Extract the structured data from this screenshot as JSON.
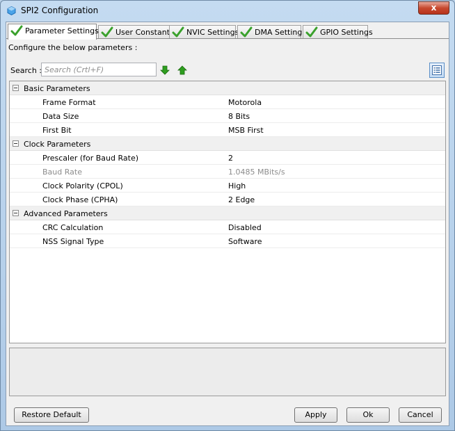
{
  "window": {
    "title": "SPI2 Configuration",
    "close_label": "x"
  },
  "tabs": [
    {
      "label": "Parameter Settings",
      "active": true
    },
    {
      "label": "User Constants",
      "active": false
    },
    {
      "label": "NVIC Settings",
      "active": false
    },
    {
      "label": "DMA Settings",
      "active": false
    },
    {
      "label": "GPIO Settings",
      "active": false
    }
  ],
  "instruction": "Configure the below parameters :",
  "search": {
    "label": "Search :",
    "placeholder": "Search (Crtl+F)"
  },
  "groups": [
    {
      "label": "Basic Parameters",
      "params": [
        {
          "name": "Frame Format",
          "value": "Motorola"
        },
        {
          "name": "Data Size",
          "value": "8 Bits"
        },
        {
          "name": "First Bit",
          "value": "MSB First"
        }
      ]
    },
    {
      "label": "Clock Parameters",
      "params": [
        {
          "name": "Prescaler (for Baud Rate)",
          "value": "2"
        },
        {
          "name": "Baud Rate",
          "value": "1.0485 MBits/s"
        },
        {
          "name": "Clock Polarity (CPOL)",
          "value": "High"
        },
        {
          "name": "Clock Phase (CPHA)",
          "value": "2 Edge"
        }
      ]
    },
    {
      "label": "Advanced Parameters",
      "params": [
        {
          "name": "CRC Calculation",
          "value": "Disabled"
        },
        {
          "name": "NSS Signal Type",
          "value": "Software"
        }
      ]
    }
  ],
  "buttons": {
    "restore_default": "Restore Default",
    "apply": "Apply",
    "ok": "Ok",
    "cancel": "Cancel"
  },
  "colors": {
    "check_green": "#3aa12c",
    "arrow_green": "#2e9e1f",
    "title_bar": "#c4dbf1",
    "close_red": "#c7492f"
  }
}
